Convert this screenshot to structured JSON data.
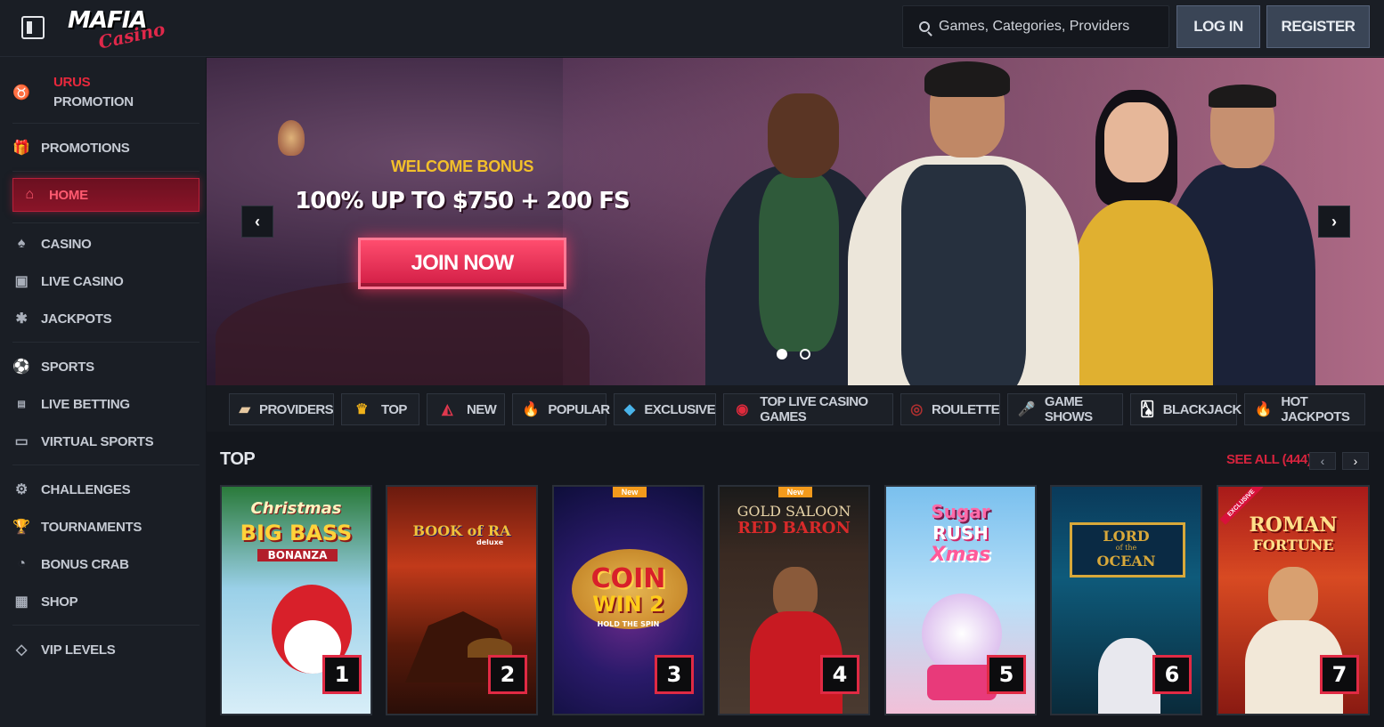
{
  "header": {
    "logo_main": "MAFIA",
    "logo_sub": "Casino",
    "search_placeholder": "Games, Categories, Providers",
    "login_label": "LOG IN",
    "register_label": "REGISTER"
  },
  "sidebar": {
    "urus_top": "URUS",
    "urus_bottom": "PROMOTION",
    "items": [
      {
        "label": "PROMOTIONS",
        "icon": "gift-icon"
      },
      {
        "label": "HOME",
        "icon": "home-icon"
      },
      {
        "label": "CASINO",
        "icon": "spade-icon"
      },
      {
        "label": "LIVE CASINO",
        "icon": "live-casino-icon"
      },
      {
        "label": "JACKPOTS",
        "icon": "jackpot-icon"
      },
      {
        "label": "SPORTS",
        "icon": "soccer-ball-icon"
      },
      {
        "label": "LIVE BETTING",
        "icon": "live-betting-icon"
      },
      {
        "label": "VIRTUAL SPORTS",
        "icon": "virtual-sports-icon"
      },
      {
        "label": "CHALLENGES",
        "icon": "challenge-icon"
      },
      {
        "label": "TOURNAMENTS",
        "icon": "trophy-icon"
      },
      {
        "label": "BONUS CRAB",
        "icon": "crab-icon"
      },
      {
        "label": "SHOP",
        "icon": "shop-icon"
      },
      {
        "label": "VIP LEVELS",
        "icon": "diamond-icon"
      }
    ]
  },
  "hero": {
    "welcome": "WELCOME BONUS",
    "offer": "100% UP TO $750 + 200 FS",
    "cta": "JOIN NOW",
    "prev": "‹",
    "next": "›"
  },
  "categories": [
    {
      "label": "PROVIDERS"
    },
    {
      "label": "TOP"
    },
    {
      "label": "NEW"
    },
    {
      "label": "POPULAR"
    },
    {
      "label": "EXCLUSIVE"
    },
    {
      "label": "TOP LIVE CASINO GAMES"
    },
    {
      "label": "ROULETTE"
    },
    {
      "label": "GAME SHOWS"
    },
    {
      "label": "BLACKJACK"
    },
    {
      "label": "HOT JACKPOTS"
    }
  ],
  "top_section": {
    "title": "TOP",
    "see_all": "SEE ALL (444)",
    "games": [
      {
        "title_a": "Christmas",
        "title_b": "BIG BASS",
        "title_c": "BONANZA",
        "rank": "1"
      },
      {
        "title_a": "BOOK of RA",
        "title_b": "",
        "title_c": "deluxe",
        "rank": "2"
      },
      {
        "title_a": "COIN",
        "title_b": "WIN 2",
        "title_c": "HOLD THE SPIN",
        "rank": "3",
        "badge": "New"
      },
      {
        "title_a": "GOLD SALOON",
        "title_b": "RED BARON",
        "title_c": "",
        "rank": "4",
        "badge": "New"
      },
      {
        "title_a": "Sugar",
        "title_b": "RUSH",
        "title_c": "Xmas",
        "rank": "5"
      },
      {
        "title_a": "LORD",
        "title_b": "of the",
        "title_c": "OCEAN",
        "rank": "6"
      },
      {
        "title_a": "ROMAN",
        "title_b": "FORTUNE",
        "title_c": "",
        "rank": "7",
        "badge": "EXCLUSIVE"
      }
    ]
  },
  "colors": {
    "accent_red": "#d6233d",
    "gold": "#f3c02a",
    "bg": "#14171d"
  }
}
